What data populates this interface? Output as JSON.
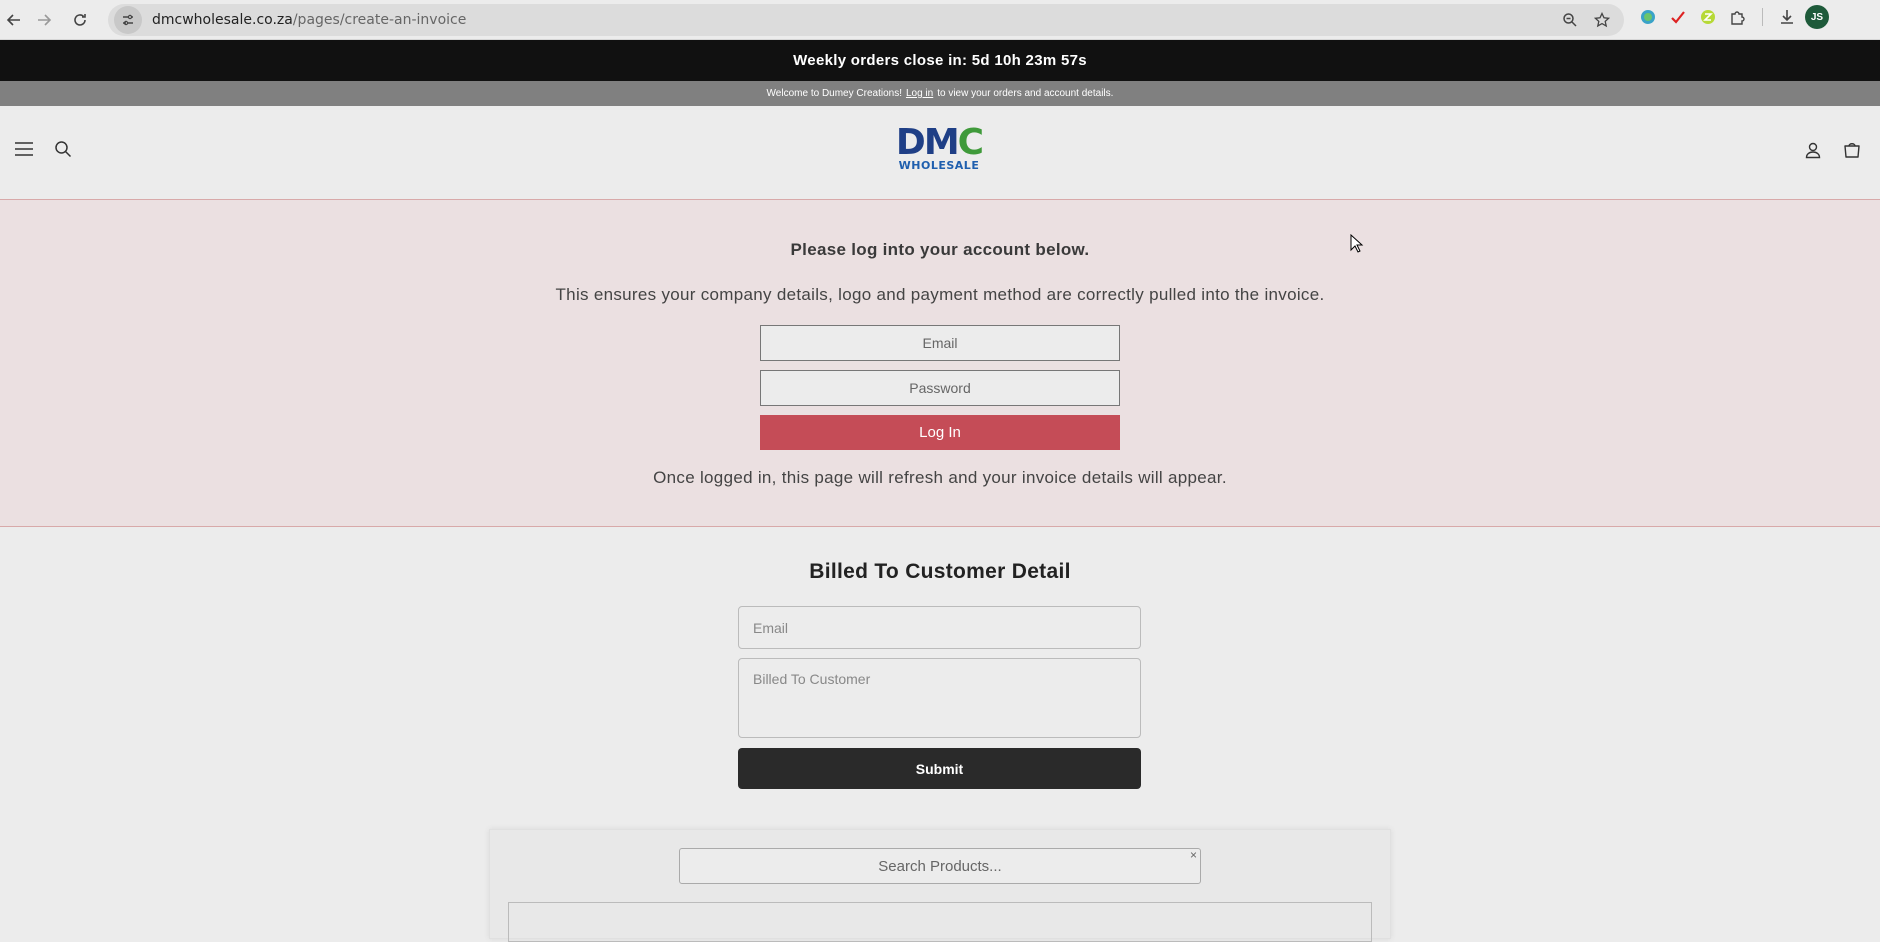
{
  "browser": {
    "url_domain": "dmcwholesale.co.za",
    "url_path": "/pages/create-an-invoice",
    "profile_initials": "JS"
  },
  "announcement": {
    "text": "Weekly orders close in: 5d 10h 23m 57s"
  },
  "welcome_bar": {
    "prefix": "Welcome to Dumey Creations!",
    "link": "Log in",
    "suffix": "to view your orders and account details."
  },
  "header": {
    "logo_main": "DMC",
    "logo_sub": "WHOLESALE"
  },
  "login": {
    "title": "Please log into your account below.",
    "description": "This ensures your company details, logo and payment method are correctly pulled into the invoice.",
    "email_placeholder": "Email",
    "password_placeholder": "Password",
    "button_label": "Log In",
    "note": "Once logged in, this page will refresh and your invoice details will appear."
  },
  "billed": {
    "title": "Billed To Customer Detail",
    "email_placeholder": "Email",
    "customer_placeholder": "Billed To Customer",
    "submit_label": "Submit"
  },
  "products": {
    "search_placeholder": "Search Products...",
    "clear_label": "×"
  },
  "colors": {
    "announce_bg": "#111111",
    "login_bg": "#ebe0e1",
    "login_button": "#c54c57",
    "submit_button": "#2a2a2a"
  }
}
